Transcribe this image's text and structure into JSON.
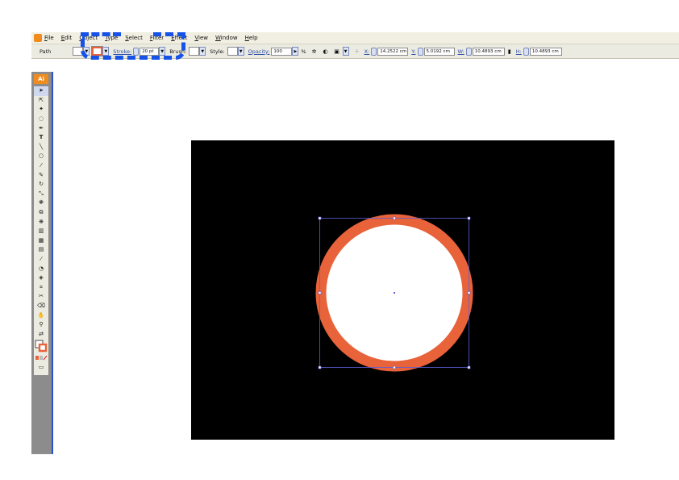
{
  "menubar": {
    "items": [
      "File",
      "Edit",
      "Object",
      "Type",
      "Select",
      "Filter",
      "Effect",
      "View",
      "Window",
      "Help"
    ]
  },
  "controlbar": {
    "selection_label": "Path",
    "stroke_label": "Stroke:",
    "stroke_weight": "20 pt",
    "brush_label": "Brush:",
    "style_label": "Style:",
    "opacity_label": "Opacity:",
    "opacity_value": "100",
    "opacity_unit": "%",
    "x_label": "X:",
    "x_value": "14.2522 cm",
    "y_label": "Y:",
    "y_value": "5.0192 cm",
    "w_label": "W:",
    "w_value": "10.4893 cm",
    "h_label": "H:",
    "h_value": "10.4893 cm"
  },
  "toolbox": {
    "logo": "Ai"
  },
  "colors": {
    "artboard_bg": "#000000",
    "circle_stroke": "#e8623a",
    "circle_fill": "#ffffff",
    "selection": "#5b5fd6",
    "highlight": "#1652e8",
    "toolbox_bg": "#8c8c8c"
  }
}
